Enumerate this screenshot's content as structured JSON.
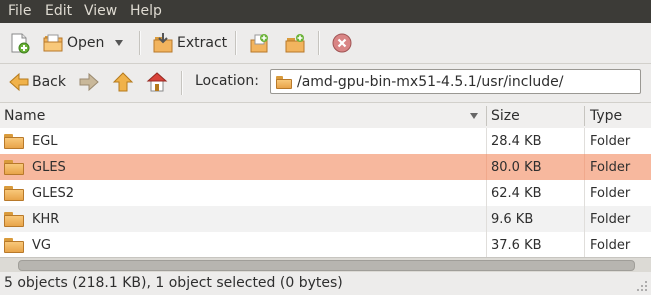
{
  "menu": [
    "File",
    "Edit",
    "View",
    "Help"
  ],
  "toolbar": {
    "open_label": "Open",
    "extract_label": "Extract"
  },
  "location": {
    "back_label": "Back",
    "label": "Location:",
    "path": "/amd-gpu-bin-mx51-4.5.1/usr/include/"
  },
  "columns": {
    "name": "Name",
    "size": "Size",
    "type": "Type"
  },
  "files": [
    {
      "name": "EGL",
      "size": "28.4 KB",
      "type": "Folder"
    },
    {
      "name": "GLES",
      "size": "80.0 KB",
      "type": "Folder"
    },
    {
      "name": "GLES2",
      "size": "62.4 KB",
      "type": "Folder"
    },
    {
      "name": "KHR",
      "size": "9.6 KB",
      "type": "Folder"
    },
    {
      "name": "VG",
      "size": "37.6 KB",
      "type": "Folder"
    }
  ],
  "selected_index": 1,
  "colors": {
    "selection": "#f7b89e",
    "menubar": "#3c3b37",
    "alt_row": "#f2f2f2"
  },
  "status": "5 objects (218.1 KB), 1 object selected (0 bytes)"
}
